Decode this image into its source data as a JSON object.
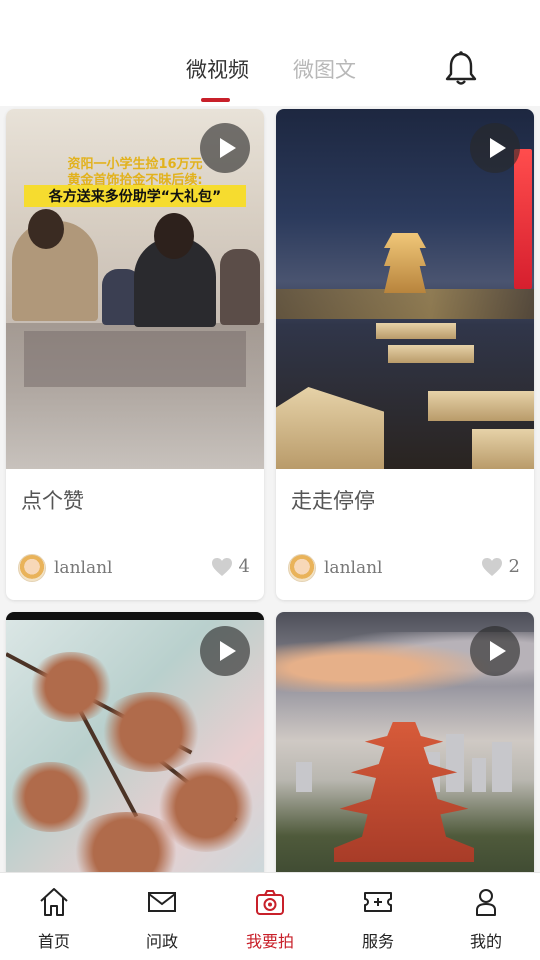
{
  "tabs": [
    {
      "label": "微视频",
      "active": true
    },
    {
      "label": "微图文",
      "active": false
    }
  ],
  "header": {
    "bell_icon": "bell-icon"
  },
  "cards": [
    {
      "title": "点个赞",
      "author": "lanlanl",
      "likes": "4",
      "thumbnail_caption": [
        "资阳一小学生捡16万元",
        "黄金首饰拾金不昧后续:",
        "各方送来多份助学“大礼包”"
      ]
    },
    {
      "title": "走走停停",
      "author": "lanlanl",
      "likes": "2"
    },
    {
      "title": "",
      "author": "",
      "likes": ""
    },
    {
      "title": "",
      "author": "",
      "likes": ""
    }
  ],
  "bottom_nav": [
    {
      "label": "首页",
      "icon": "home-icon",
      "active": false
    },
    {
      "label": "问政",
      "icon": "mail-icon",
      "active": false
    },
    {
      "label": "我要拍",
      "icon": "camera-icon",
      "active": true
    },
    {
      "label": "服务",
      "icon": "ticket-icon",
      "active": false
    },
    {
      "label": "我的",
      "icon": "user-icon",
      "active": false
    }
  ],
  "colors": {
    "accent": "#c8202a",
    "inactive_tab": "#b8b8b8"
  }
}
